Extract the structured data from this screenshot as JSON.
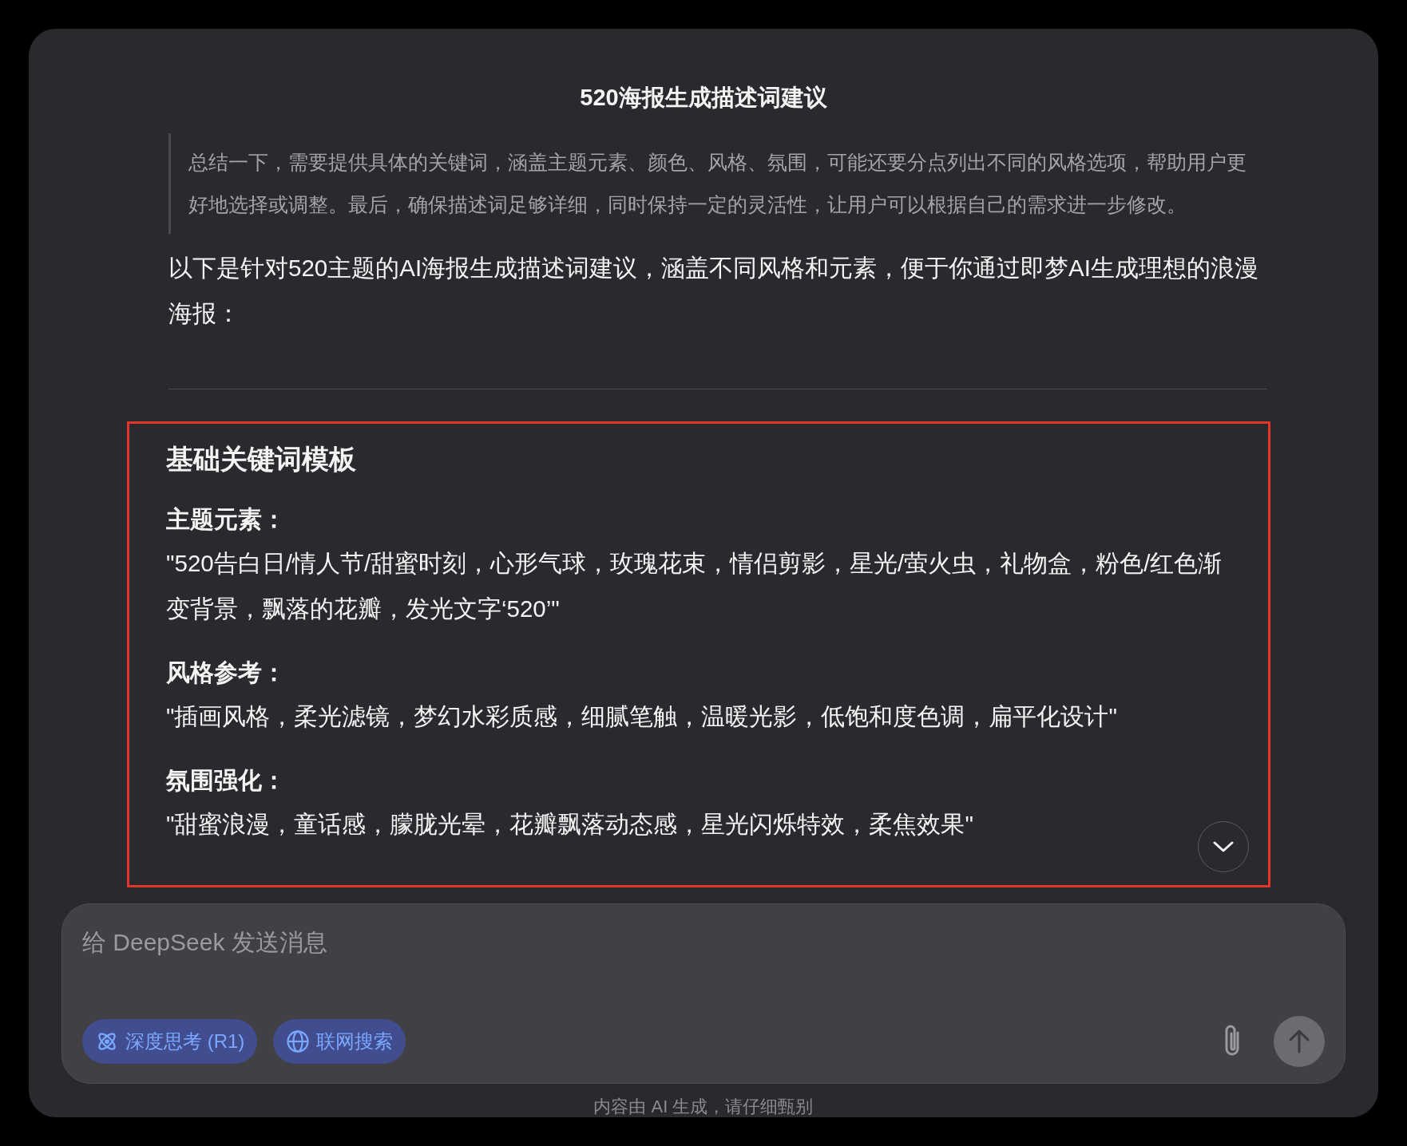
{
  "window": {
    "title": "520海报生成描述词建议"
  },
  "thinking_quote": "总结一下，需要提供具体的关键词，涵盖主题元素、颜色、风格、氛围，可能还要分点列出不同的风格选项，帮助用户更好地选择或调整。最后，确保描述词足够详细，同时保持一定的灵活性，让用户可以根据自己的需求进一步修改。",
  "intro": "以下是针对520主题的AI海报生成描述词建议，涵盖不同风格和元素，便于你通过即梦AI生成理想的浪漫海报：",
  "section": {
    "heading": "基础关键词模板",
    "items": [
      {
        "label": "主题元素：",
        "text": "\"520告白日/情人节/甜蜜时刻，心形气球，玫瑰花束，情侣剪影，星光/萤火虫，礼物盒，粉色/红色渐变背景，飘落的花瓣，发光文字‘520’\""
      },
      {
        "label": "风格参考：",
        "text": "\"插画风格，柔光滤镜，梦幻水彩质感，细腻笔触，温暖光影，低饱和度色调，扁平化设计\""
      },
      {
        "label": "氛围强化：",
        "text": "\"甜蜜浪漫，童话感，朦胧光晕，花瓣飘落动态感，星光闪烁特效，柔焦效果\""
      }
    ]
  },
  "composer": {
    "placeholder": "给 DeepSeek 发送消息",
    "toggles": [
      {
        "kind": "atom",
        "label": "深度思考 (R1)",
        "selected": true
      },
      {
        "kind": "globe",
        "label": "联网搜索",
        "selected": true
      }
    ],
    "send_disabled": true
  },
  "footer": "内容由 AI 生成，请仔细甄别"
}
